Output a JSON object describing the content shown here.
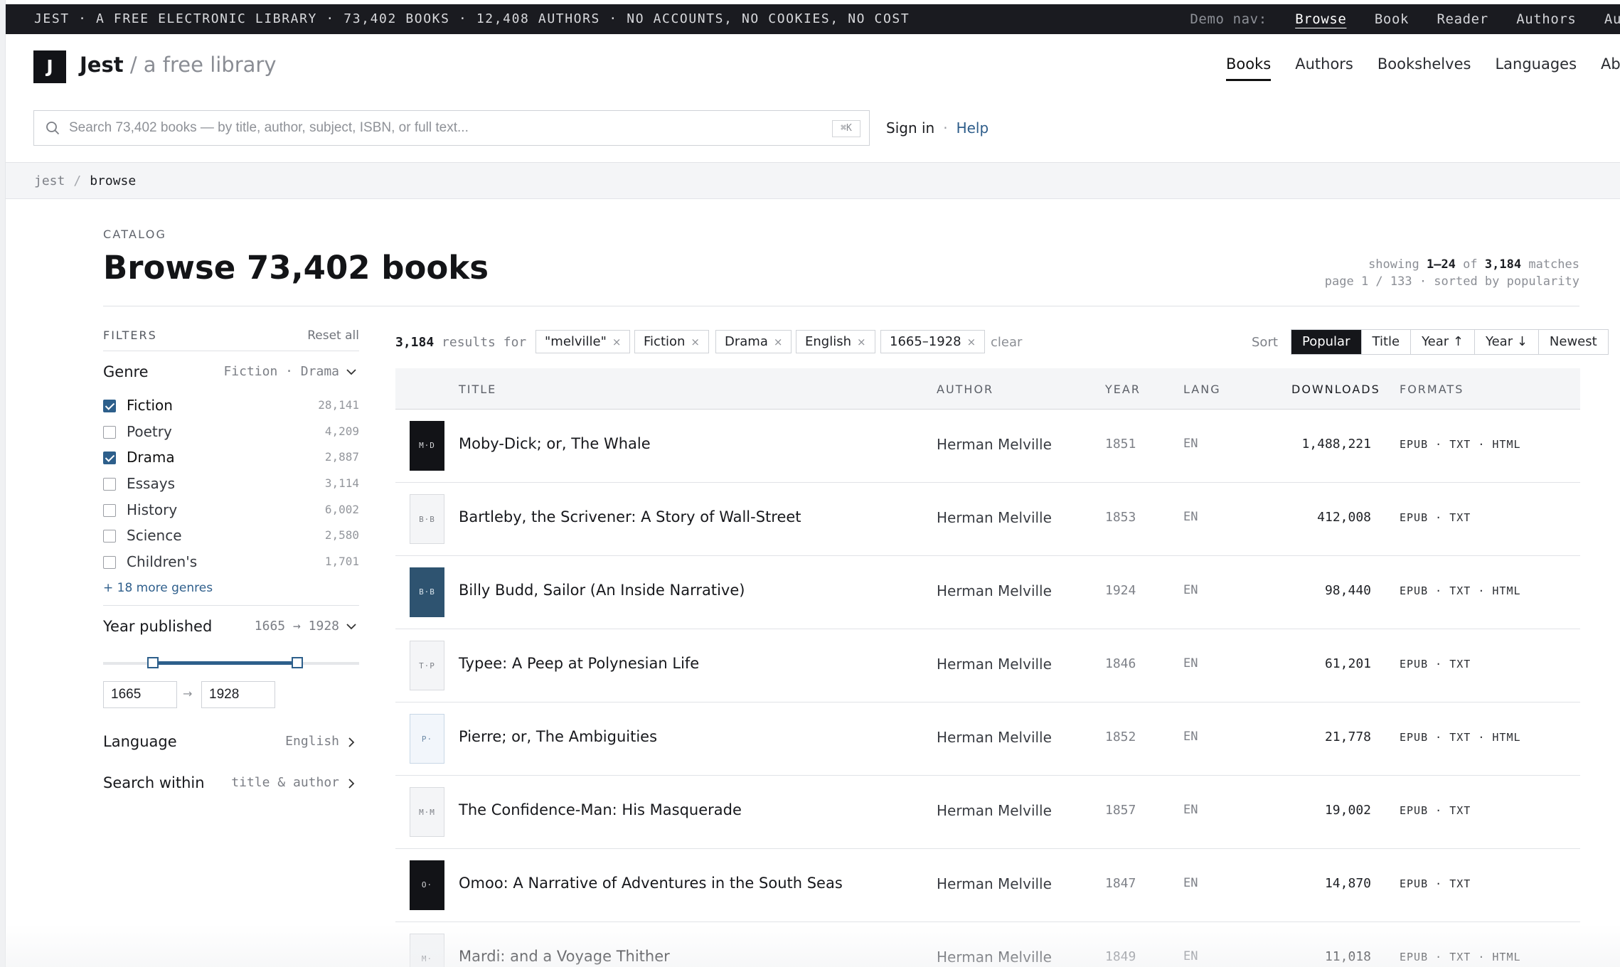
{
  "topbar": {
    "tagline": "JEST · A FREE ELECTRONIC LIBRARY · 73,402 BOOKS · 12,408 AUTHORS · NO ACCOUNTS, NO COOKIES, NO COST",
    "demo_label": "Demo nav:",
    "demo_links": [
      "Browse",
      "Book",
      "Reader",
      "Authors",
      "Au"
    ]
  },
  "header": {
    "logo_letter": "J",
    "brand": "Jest",
    "brand_tag": "/ a free library",
    "nav": [
      "Books",
      "Authors",
      "Bookshelves",
      "Languages",
      "Abou"
    ],
    "nav_active": "Books"
  },
  "search": {
    "placeholder": "Search 73,402 books — by title, author, subject, ISBN, or full text...",
    "shortcut": "⌘K"
  },
  "account": {
    "sign_in": "Sign in",
    "separator": "·",
    "help": "Help"
  },
  "breadcrumb": {
    "root": "jest",
    "sep": "/",
    "current": "browse"
  },
  "catalog": {
    "eyebrow": "CATALOG",
    "title": "Browse 73,402 books",
    "showing_prefix": "showing",
    "showing_range": "1–24",
    "showing_of": "of",
    "showing_total": "3,184",
    "showing_suffix": "matches",
    "page_line": "page 1 / 133 · sorted by popularity"
  },
  "filters": {
    "heading": "FILTERS",
    "reset": "Reset all",
    "genre": {
      "title": "Genre",
      "summary": "Fiction · Drama",
      "items": [
        {
          "label": "Fiction",
          "count": "28,141",
          "checked": true
        },
        {
          "label": "Poetry",
          "count": "4,209",
          "checked": false
        },
        {
          "label": "Drama",
          "count": "2,887",
          "checked": true
        },
        {
          "label": "Essays",
          "count": "3,114",
          "checked": false
        },
        {
          "label": "History",
          "count": "6,002",
          "checked": false
        },
        {
          "label": "Science",
          "count": "2,580",
          "checked": false
        },
        {
          "label": "Children's",
          "count": "1,701",
          "checked": false
        }
      ],
      "more": "+ 18 more genres"
    },
    "year": {
      "title": "Year published",
      "summary": "1665 → 1928",
      "from": "1665",
      "to": "1928",
      "arrow": "→",
      "range_fraction": [
        0.18,
        0.77
      ]
    },
    "language": {
      "title": "Language",
      "value": "English"
    },
    "search_within": {
      "title": "Search within",
      "value": "title & author"
    }
  },
  "results": {
    "count": "3,184",
    "count_suffix": "results for",
    "chips": [
      "\"melville\"",
      "Fiction",
      "Drama",
      "English",
      "1665–1928"
    ],
    "chip_close": "×",
    "clear": "clear",
    "sort_label": "Sort",
    "sort_options": [
      "Popular",
      "Title",
      "Year ↑",
      "Year ↓",
      "Newest"
    ],
    "sort_active": "Popular"
  },
  "table": {
    "columns": [
      "TITLE",
      "AUTHOR",
      "YEAR",
      "LANG",
      "DOWNLOADS",
      "FORMATS"
    ],
    "rows": [
      {
        "cover": "M·D",
        "cover_style": "dark",
        "title": "Moby-Dick; or, The Whale",
        "author": "Herman Melville",
        "year": "1851",
        "lang": "EN",
        "downloads": "1,488,221",
        "formats": "EPUB · TXT · HTML"
      },
      {
        "cover": "B·B",
        "cover_style": "light",
        "title": "Bartleby, the Scrivener: A Story of Wall-Street",
        "author": "Herman Melville",
        "year": "1853",
        "lang": "EN",
        "downloads": "412,008",
        "formats": "EPUB · TXT"
      },
      {
        "cover": "B·B",
        "cover_style": "blue",
        "title": "Billy Budd, Sailor (An Inside Narrative)",
        "author": "Herman Melville",
        "year": "1924",
        "lang": "EN",
        "downloads": "98,440",
        "formats": "EPUB · TXT · HTML"
      },
      {
        "cover": "T·P",
        "cover_style": "light",
        "title": "Typee: A Peep at Polynesian Life",
        "author": "Herman Melville",
        "year": "1846",
        "lang": "EN",
        "downloads": "61,201",
        "formats": "EPUB · TXT"
      },
      {
        "cover": "P·",
        "cover_style": "sky",
        "title": "Pierre; or, The Ambiguities",
        "author": "Herman Melville",
        "year": "1852",
        "lang": "EN",
        "downloads": "21,778",
        "formats": "EPUB · TXT · HTML"
      },
      {
        "cover": "M·M",
        "cover_style": "light",
        "title": "The Confidence-Man: His Masquerade",
        "author": "Herman Melville",
        "year": "1857",
        "lang": "EN",
        "downloads": "19,002",
        "formats": "EPUB · TXT"
      },
      {
        "cover": "O·",
        "cover_style": "dark",
        "title": "Omoo: A Narrative of Adventures in the South Seas",
        "author": "Herman Melville",
        "year": "1847",
        "lang": "EN",
        "downloads": "14,870",
        "formats": "EPUB · TXT"
      },
      {
        "cover": "M·",
        "cover_style": "light",
        "title": "Mardi: and a Voyage Thither",
        "author": "Herman Melville",
        "year": "1849",
        "lang": "EN",
        "downloads": "11,018",
        "formats": "EPUB · TXT · HTML"
      }
    ]
  },
  "colors": {
    "accent": "#2d5f8b",
    "dark": "#1a1b20",
    "link": "#2e5d8a"
  }
}
